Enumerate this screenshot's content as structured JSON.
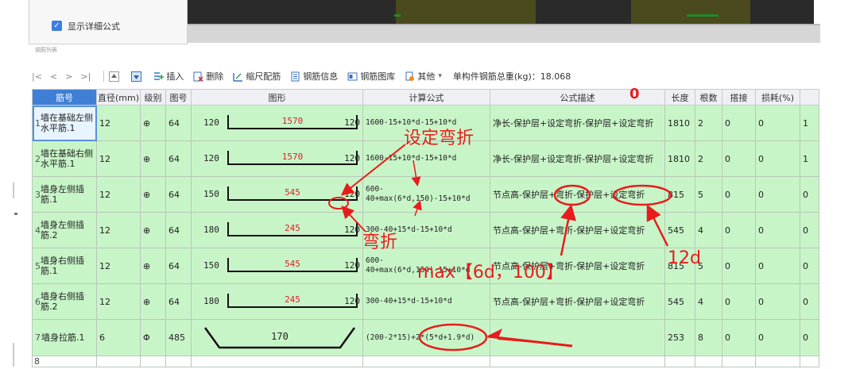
{
  "header": {
    "show_formula_label": "显示详细公式",
    "tiny_caption": "钢筋列表"
  },
  "toolbar": {
    "nav_first": "|<",
    "nav_prev": "<",
    "nav_next": ">",
    "nav_last": ">|",
    "insert": "插入",
    "delete": "删除",
    "scale": "缩尺配筋",
    "rebar_info": "钢筋信息",
    "rebar_lib": "钢筋图库",
    "other": "其他",
    "other_caret": "▾",
    "total": "单构件钢筋总重(kg)：18.068"
  },
  "table": {
    "columns": [
      "筋号",
      "直径(mm)",
      "级别",
      "图号",
      "图形",
      "计算公式",
      "公式描述",
      "长度",
      "根数",
      "搭接",
      "损耗(%)",
      ""
    ],
    "rows": [
      {
        "num": "1",
        "name": "墙在基础左侧水平筋.1",
        "dia": "12",
        "grade": "⊕",
        "fig": "64",
        "shape_left": "120",
        "shape_mid": "1570",
        "shape_right": "120",
        "formula": "1600-15+10*d-15+10*d",
        "desc": "净长-保护层+设定弯折-保护层+设定弯折",
        "length": "1810",
        "count": "2",
        "lap": "0",
        "loss": "0",
        "extra": "1"
      },
      {
        "num": "2",
        "name": "墙在基础右侧水平筋.1",
        "dia": "12",
        "grade": "⊕",
        "fig": "64",
        "shape_left": "120",
        "shape_mid": "1570",
        "shape_right": "120",
        "formula": "1600-15+10*d-15+10*d",
        "desc": "净长-保护层+设定弯折-保护层+设定弯折",
        "length": "1810",
        "count": "2",
        "lap": "0",
        "loss": "0",
        "extra": "1"
      },
      {
        "num": "3",
        "name": "墙身左侧插筋.1",
        "dia": "12",
        "grade": "⊕",
        "fig": "64",
        "shape_left": "150",
        "shape_mid": "545",
        "shape_right": "120",
        "formula": "600-40+max(6*d,150)-15+10*d",
        "desc": "节点高-保护层+弯折-保护层+设定弯折",
        "length": "815",
        "count": "5",
        "lap": "0",
        "loss": "0",
        "extra": "0"
      },
      {
        "num": "4",
        "name": "墙身左侧插筋.2",
        "dia": "12",
        "grade": "⊕",
        "fig": "64",
        "shape_left": "180",
        "shape_mid": "245",
        "shape_right": "120",
        "formula": "300-40+15*d-15+10*d",
        "desc": "节点高-保护层+弯折-保护层+设定弯折",
        "length": "545",
        "count": "4",
        "lap": "0",
        "loss": "0",
        "extra": "0"
      },
      {
        "num": "5",
        "name": "墙身右侧插筋.1",
        "dia": "12",
        "grade": "⊕",
        "fig": "64",
        "shape_left": "150",
        "shape_mid": "545",
        "shape_right": "120",
        "formula": "600-40+max(6*d,150)-15+10*d",
        "desc": "节点高-保护层+弯折-保护层+设定弯折",
        "length": "815",
        "count": "5",
        "lap": "0",
        "loss": "0",
        "extra": "0"
      },
      {
        "num": "6",
        "name": "墙身右侧插筋.2",
        "dia": "12",
        "grade": "⊕",
        "fig": "64",
        "shape_left": "180",
        "shape_mid": "245",
        "shape_right": "120",
        "formula": "300-40+15*d-15+10*d",
        "desc": "节点高-保护层+弯折-保护层+设定弯折",
        "length": "545",
        "count": "4",
        "lap": "0",
        "loss": "0",
        "extra": "0"
      },
      {
        "num": "7",
        "name": "墙身拉筋.1",
        "dia": "6",
        "grade": "Φ",
        "fig": "485",
        "shape_mid": "170",
        "formula": "(200-2*15)+2*(5*d+1.9*d)",
        "desc": "",
        "length": "253",
        "count": "8",
        "lap": "0",
        "loss": "0",
        "extra": "0"
      },
      {
        "num": "8"
      }
    ]
  },
  "annotations": {
    "zero": "0",
    "set_bend": "设定弯折",
    "bend": "弯折",
    "max_note": "max【6d，100】",
    "twelve_d": "12d"
  },
  "colors": {
    "row_green": "#c8f5c8",
    "header_blue": "#3f7fd6",
    "annotation_red": "#e81c1c",
    "shape_mid_red": "#e0202a"
  }
}
